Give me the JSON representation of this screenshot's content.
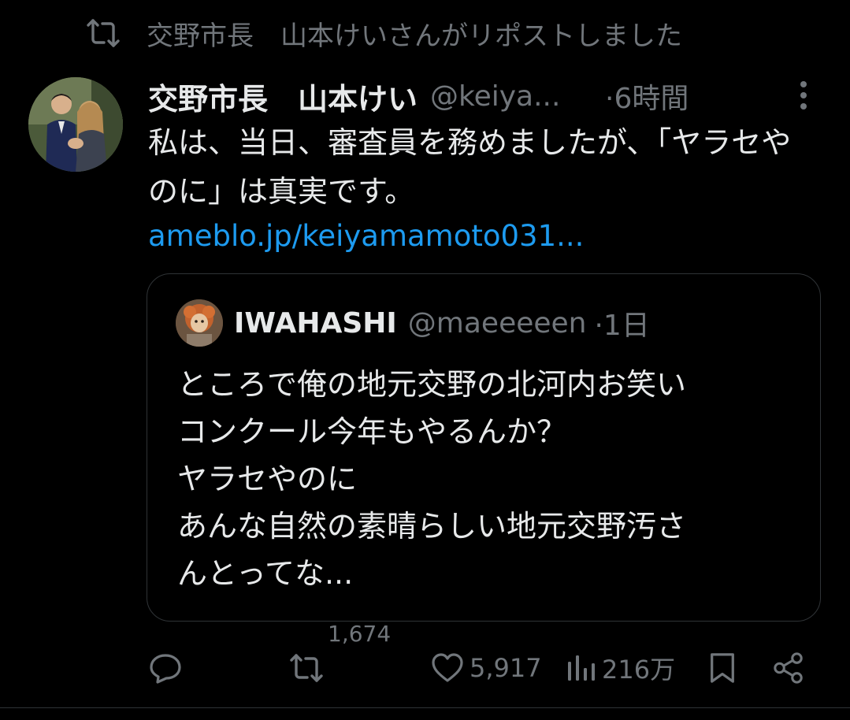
{
  "repost_header": {
    "icon": "repost-icon",
    "text": "交野市長　山本けいさんがリポストしました"
  },
  "post": {
    "author_name": "交野市長　山本けい",
    "handle": "@keiya...",
    "time": "·6時間",
    "text": "私は、当日、審査員を務めましたが、「ヤラセやのに」は真実です。",
    "link": "ameblo.jp/keiyamamoto031..."
  },
  "quote": {
    "author_name": "IWAHASHI",
    "handle": "@maeeeeen",
    "time": "·1日",
    "lines": [
      "ところで俺の地元交野の北河内お笑い",
      "コンクール今年もやるんか？",
      "ヤラセやのに",
      "あんな自然の素晴らしい地元交野汚さ",
      "んとってな..."
    ]
  },
  "actions": {
    "reply_icon": "reply-icon",
    "repost_icon": "repost-icon",
    "repost_count": "1,674",
    "like_icon": "heart-icon",
    "like_count": "5,917",
    "views_icon": "views-icon",
    "views_count": "216万",
    "bookmark_icon": "bookmark-icon",
    "share_icon": "share-icon"
  },
  "colors": {
    "background": "#000000",
    "text_primary": "#e7e9ea",
    "text_secondary": "#71767b",
    "link": "#1d9bf0",
    "border": "#2f3336"
  }
}
